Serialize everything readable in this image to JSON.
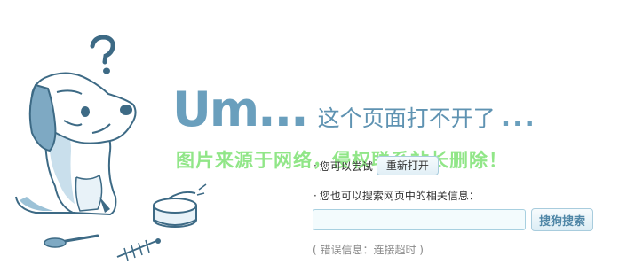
{
  "headline": {
    "big": "Um...",
    "message": "这个页面打不开了",
    "trailing_dots": "..."
  },
  "watermark": "图片来源于网络，侵权联系站长删除！",
  "tips": {
    "bullet": "·",
    "try_text": "您可以尝试",
    "reopen_button": "重新打开",
    "search_text": "您也可以搜索网页中的相关信息："
  },
  "search": {
    "input_value": "",
    "button_label": "搜狗搜索"
  },
  "error": {
    "text": "( 错误信息：连接超时 )"
  },
  "colors": {
    "accent": "#6a9fbd",
    "watermark": "#6cde60",
    "button_border": "#a8ccdd"
  },
  "icons": [
    "confused-dog-illustration",
    "question-mark-icon",
    "tin-can-icon",
    "fish-bone-icon",
    "spoon-icon"
  ]
}
